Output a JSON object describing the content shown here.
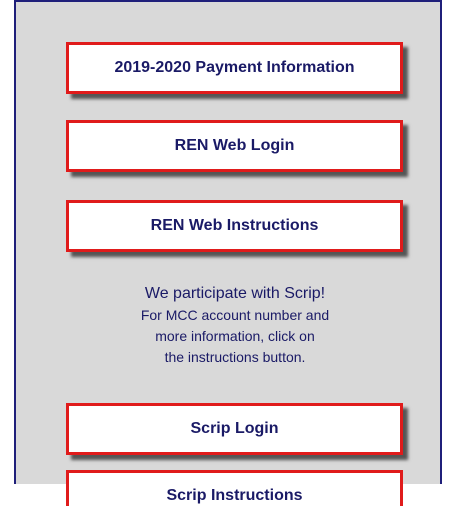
{
  "buttons": {
    "payment": "2019-2020 Payment Information",
    "renweb_login": "REN Web Login",
    "renweb_instructions": "REN Web Instructions",
    "scrip_login": "Scrip Login",
    "scrip_instructions": "Scrip Instructions"
  },
  "scrip_info": {
    "heading": "We participate with Scrip!",
    "line1": "For MCC account number and",
    "line2": "more information, click on",
    "line3": "the instructions button."
  },
  "colors": {
    "panel_bg": "#d9d9d9",
    "button_border": "#e01b1b",
    "text": "#1a1a66",
    "frame": "#1f1f7a"
  }
}
